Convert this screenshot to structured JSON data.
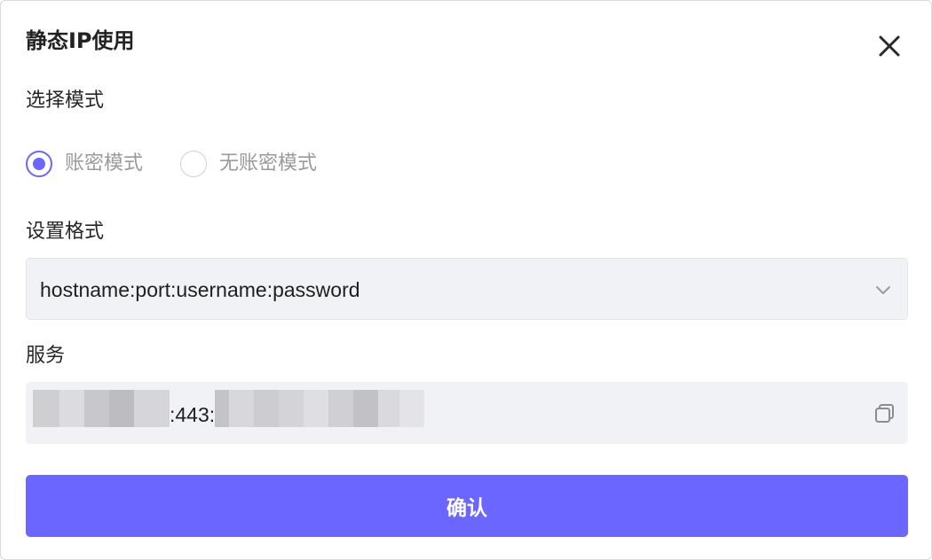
{
  "dialog": {
    "title": "静态IP使用",
    "close_icon": "close-icon"
  },
  "mode": {
    "label": "选择模式",
    "options": [
      {
        "label": "账密模式",
        "checked": true
      },
      {
        "label": "无账密模式",
        "checked": false
      }
    ]
  },
  "format": {
    "label": "设置格式",
    "selected": "hostname:port:username:password",
    "icon": "chevron-down-icon"
  },
  "service": {
    "label": "服务",
    "port_text": ":443:",
    "copy_icon": "copy-icon"
  },
  "confirm": {
    "label": "确认"
  },
  "colors": {
    "accent": "#6a66ff",
    "field_bg": "#f1f2f5"
  }
}
